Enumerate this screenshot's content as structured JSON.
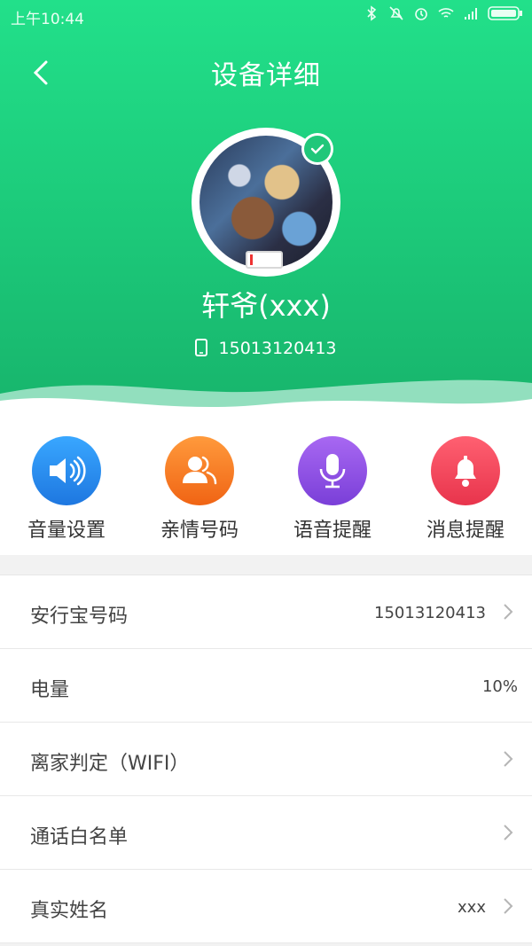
{
  "status_bar": {
    "time": "上午10:44"
  },
  "nav": {
    "title": "设备详细"
  },
  "device": {
    "name": "轩爷(xxx)",
    "phone": "15013120413"
  },
  "quick_actions": [
    {
      "label": "音量设置",
      "icon": "speaker-icon",
      "color": "#2a8df0"
    },
    {
      "label": "亲情号码",
      "icon": "contacts-icon",
      "color": "#f57b25"
    },
    {
      "label": "语音提醒",
      "icon": "microphone-icon",
      "color": "#8d4fe0"
    },
    {
      "label": "消息提醒",
      "icon": "bell-icon",
      "color": "#f0445a"
    }
  ],
  "rows": [
    {
      "label": "安行宝号码",
      "value": "15013120413"
    },
    {
      "label": "电量",
      "value": "10%"
    },
    {
      "label": "离家判定（WIFI）",
      "value": ""
    },
    {
      "label": "通话白名单",
      "value": ""
    },
    {
      "label": "真实姓名",
      "value": "xxx"
    }
  ],
  "colors": {
    "header": "#1cc879",
    "accent_check": "#20c77a",
    "battery_low": "#e33333"
  },
  "battery_level": 0.1
}
